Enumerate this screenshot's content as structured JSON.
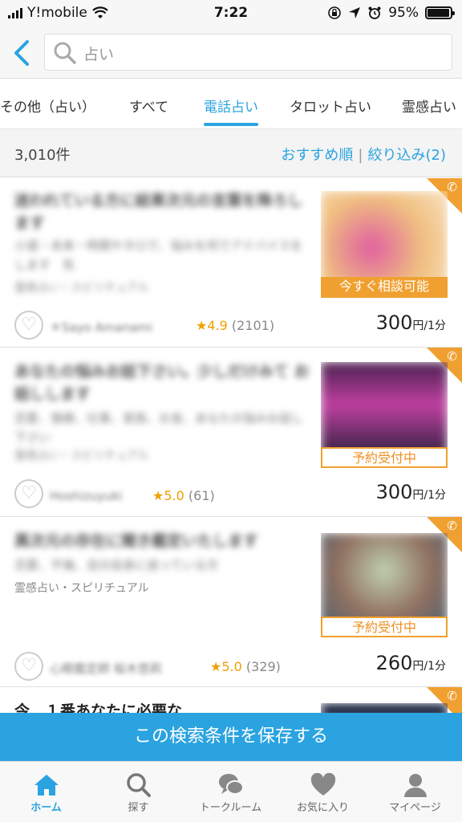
{
  "status_bar": {
    "carrier": "Y!mobile",
    "time": "7:22",
    "battery": "95%",
    "battery_level": 0.95
  },
  "search": {
    "query": "占い"
  },
  "tabs": [
    {
      "label": "その他（占い）"
    },
    {
      "label": "すべて"
    },
    {
      "label": "電話占い",
      "active": true
    },
    {
      "label": "タロット占い"
    },
    {
      "label": "霊感占い"
    }
  ],
  "results": {
    "count": "3,010件",
    "sort_label": "おすすめ順",
    "filter_label": "絞り込み(2)"
  },
  "listings": [
    {
      "title": "迷われている方に結果次元の言葉を降ろします",
      "desc": "小道・未来・時期やタロで、悩みを何でアドバイスをします　気",
      "category": "霊感占い・スピリチュアル",
      "badge": "今すぐ相談可能",
      "badge_type": "now",
      "user": "＊Sayo Amanami",
      "rating": "★4.9",
      "reviews": "(2101)",
      "price": "300",
      "unit": "円/1分"
    },
    {
      "title": "あなたの悩みお話下さい。少しだけみて お話しします",
      "desc": "恋愛、復縁、仕事、家族、お金、あなたの悩みお話し下さい",
      "category": "霊感占い・スピリチュアル",
      "badge": "予約受付中",
      "badge_type": "resv",
      "user": "Hoshizuyuki",
      "rating": "★5.0",
      "reviews": "(61)",
      "price": "300",
      "unit": "円/1分"
    },
    {
      "title": "異次元の存在に聞き鑑定いたします",
      "desc": "恋愛、不倫、自分自身に迷っている方",
      "category": "霊感占い・スピリチュアル",
      "badge": "予約受付中",
      "badge_type": "resv",
      "user": "心眼鑑定師 桜木悠莉",
      "rating": "★5.0",
      "reviews": "(329)",
      "price": "260",
      "unit": "円/1分"
    },
    {
      "title": "今、１番あなたに必要な"
    }
  ],
  "save_button": "この検索条件を保存する",
  "bottom_nav": [
    {
      "label": "ホーム",
      "icon": "home-icon",
      "active": true
    },
    {
      "label": "探す",
      "icon": "search-icon"
    },
    {
      "label": "トークルーム",
      "icon": "chat-icon"
    },
    {
      "label": "お気に入り",
      "icon": "heart-icon"
    },
    {
      "label": "マイページ",
      "icon": "person-icon"
    }
  ],
  "colors": {
    "accent": "#2aa3e0",
    "orange": "#f0a030"
  }
}
